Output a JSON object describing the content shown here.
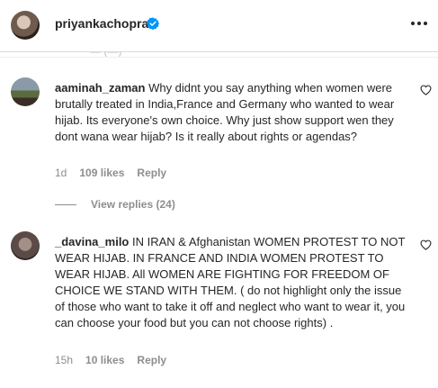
{
  "header": {
    "username": "priyankachopra"
  },
  "peek_text": "— (—)",
  "comments": [
    {
      "username": "aaminah_zaman",
      "text": "Why didnt you say anything when women were brutally treated in India,France and Germany who wanted to wear hijab. Its everyone's own choice. Why just show support wen they dont wana wear hijab? Is it really about rights or agendas?",
      "time": "1d",
      "likes": "109 likes",
      "reply": "Reply",
      "view_replies": "View replies (24)"
    },
    {
      "username": "_davina_milo",
      "text": "IN IRAN & Afghanistan WOMEN PROTEST TO NOT WEAR HIJAB. IN FRANCE AND INDIA WOMEN PROTEST TO WEAR HIJAB. All WOMEN ARE FIGHTING FOR FREEDOM OF CHOICE WE STAND WITH THEM. ( do not highlight only the issue of those who want to take it off and neglect who want to wear it, you can choose your food but you can not choose rights) .",
      "time": "15h",
      "likes": "10 likes",
      "reply": "Reply"
    }
  ],
  "colors": {
    "text": "#262626",
    "secondary": "#8e8e8e",
    "verified": "#0095f6",
    "divider": "#efefef"
  }
}
